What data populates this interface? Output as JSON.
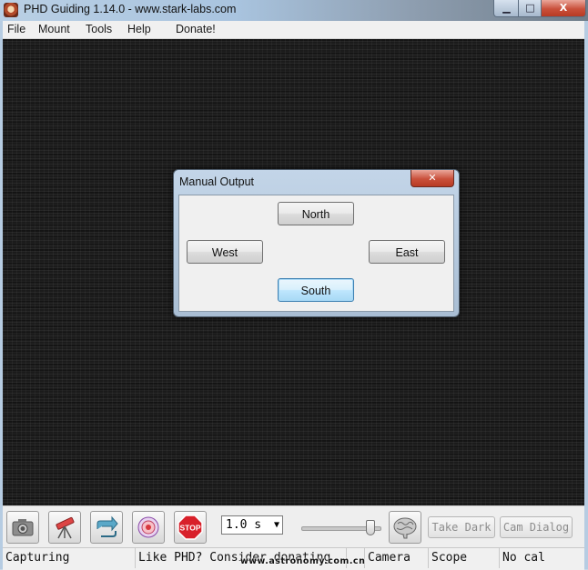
{
  "window": {
    "title": "PHD Guiding 1.14.0  -  www.stark-labs.com",
    "minimize_glyph": "▁",
    "maximize_glyph": "□",
    "close_glyph": "X"
  },
  "menu": {
    "items": [
      "File",
      "Mount",
      "Tools",
      "Help",
      "Donate!"
    ]
  },
  "dialog": {
    "title": "Manual Output",
    "close_glyph": "✕",
    "buttons": {
      "north": "North",
      "west": "West",
      "east": "East",
      "south": "South"
    },
    "focused_button": "south"
  },
  "toolbar": {
    "icons": [
      "camera-icon",
      "telescope-icon",
      "loop-icon",
      "target-icon",
      "stop-icon",
      "brain-icon"
    ],
    "stop_label": "STOP",
    "exposure_value": "1.0 s",
    "exposure_arrow": "▼",
    "gamma_level": 0.88,
    "take_dark_label": "Take Dark",
    "cam_dialog_label": "Cam Dialog"
  },
  "status": {
    "capture_state": "Capturing",
    "message": "Like PHD? Consider donating",
    "camera": "Camera",
    "scope": "Scope",
    "calibration": "No cal"
  },
  "watermark": "www.astronomy.com.cn",
  "colors": {
    "close_red": "#c9503b",
    "focus_blue": "#3c7fb1",
    "image_background": "#1b1b1b"
  }
}
